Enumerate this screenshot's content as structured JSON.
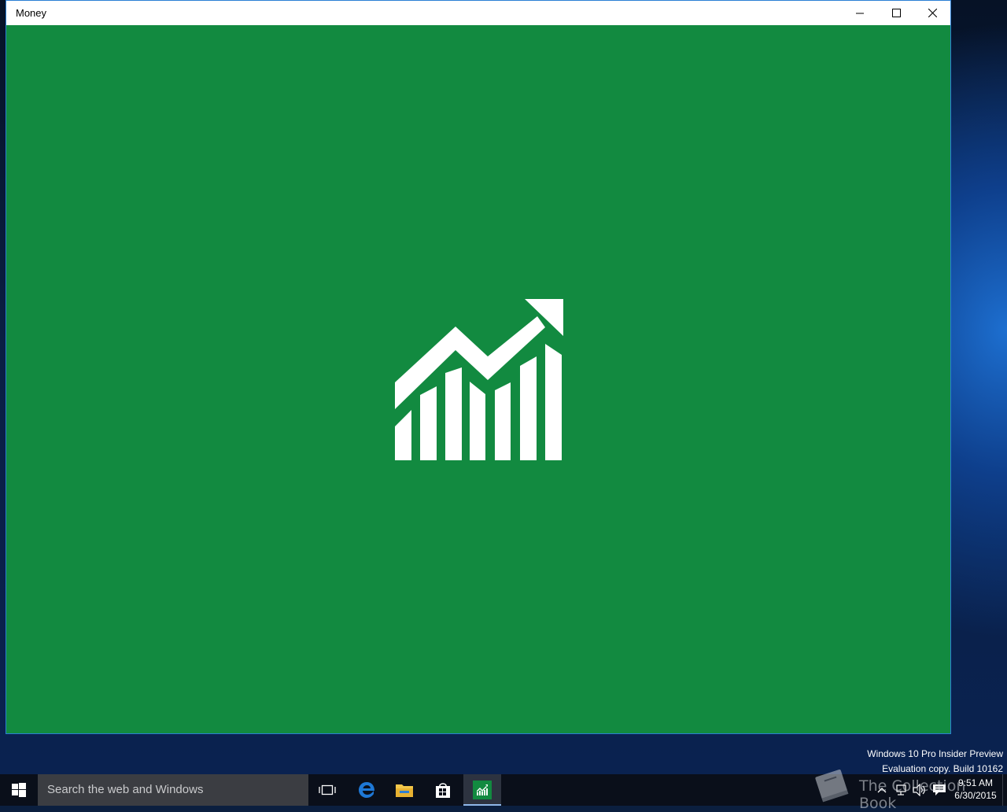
{
  "window": {
    "title": "Money",
    "background_color": "#128a40",
    "minimize_icon": "minimize-icon",
    "maximize_icon": "maximize-icon",
    "close_icon": "close-icon"
  },
  "splash": {
    "icon": "stock-chart-icon",
    "color": "#ffffff"
  },
  "watermark": {
    "line1": "Windows 10 Pro Insider Preview",
    "line2": "Evaluation copy. Build 10162",
    "collection_text": "The Collection Book"
  },
  "taskbar": {
    "search_placeholder": "Search the web and Windows",
    "apps": [
      {
        "name": "task-view",
        "icon": "task-view-icon"
      },
      {
        "name": "edge",
        "icon": "edge-icon",
        "color": "#1e78d6"
      },
      {
        "name": "file-explorer",
        "icon": "folder-icon",
        "color": "#f2c74a"
      },
      {
        "name": "store",
        "icon": "store-icon"
      },
      {
        "name": "money",
        "icon": "money-icon",
        "color": "#128a40",
        "active": true
      }
    ],
    "clock": {
      "time": "9:51 AM",
      "date": "6/30/2015"
    }
  }
}
